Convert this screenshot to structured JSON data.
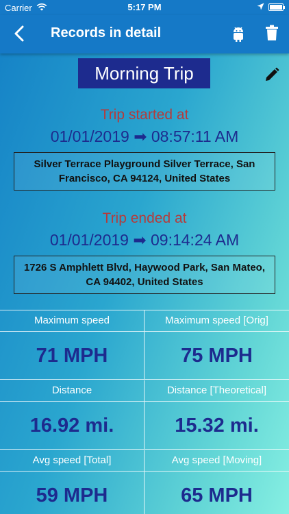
{
  "status_bar": {
    "carrier": "Carrier",
    "time": "5:17 PM"
  },
  "navbar": {
    "title": "Records in detail",
    "icons": [
      "back-arrow-icon",
      "android-icon",
      "trash-icon"
    ],
    "color": "#1579c7"
  },
  "trip": {
    "name": "Morning Trip",
    "start_label": "Trip started at",
    "start_datetime": "01/01/2019 ➡ 08:57:11 AM",
    "start_address": "Silver Terrace Playground Silver Terrace, San Francisco, CA 94124, United States",
    "end_label": "Trip ended at",
    "end_datetime": "01/01/2019 ➡ 09:14:24 AM",
    "end_address": "1726 S Amphlett Blvd, Haywood Park, San Mateo, CA 94402, United States"
  },
  "stats": [
    {
      "label": "Maximum speed",
      "value": "71 MPH"
    },
    {
      "label": "Maximum speed [Orig]",
      "value": "75 MPH"
    },
    {
      "label": "Distance",
      "value": "16.92 mi."
    },
    {
      "label": "Distance [Theoretical]",
      "value": "15.32 mi."
    },
    {
      "label": "Avg speed [Total]",
      "value": "59 MPH"
    },
    {
      "label": "Avg speed [Moving]",
      "value": "65 MPH"
    }
  ],
  "colors": {
    "accent": "#1d2b8e",
    "label_red": "#b53b3b"
  }
}
